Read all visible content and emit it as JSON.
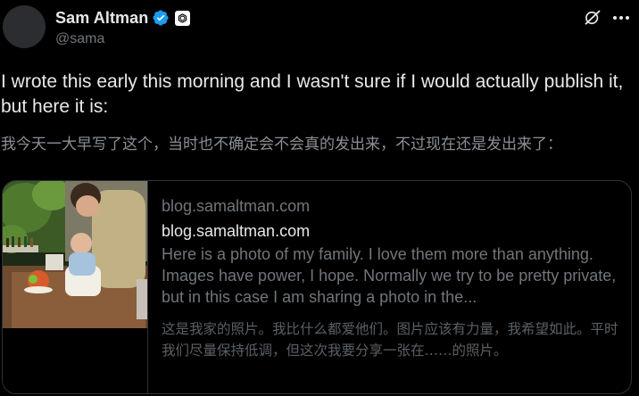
{
  "author": {
    "display_name": "Sam Altman",
    "handle": "@sama",
    "verified_icon": "verified-badge-icon",
    "affiliate_icon": "openai-logo-icon"
  },
  "header_actions": {
    "grok_icon": "grok-icon",
    "more_icon": "more-options-icon"
  },
  "tweet": {
    "text": "I wrote this early this morning and I wasn't sure if I would actually publish it, but here it is:",
    "translation": "我今天一大早写了这个，当时也不确定会不会真的发出来，不过现在还是发出来了："
  },
  "link_card": {
    "domain": "blog.samaltman.com",
    "title": "blog.samaltman.com",
    "description": "Here is a photo of my family. I love them more than anything. Images have power, I hope. Normally we try to be pretty private, but in this case I am sharing a photo in the...",
    "description_translation": "这是我家的照片。我比什么都爱他们。图片应该有力量，我希望如此。平时我们尽量保持低调，但这次我要分享一张在……的照片。"
  },
  "colors": {
    "background": "#000000",
    "text_primary": "#e7e9ea",
    "text_secondary": "#71767b",
    "verified_blue": "#1d9bf0",
    "border": "#2f3336"
  }
}
